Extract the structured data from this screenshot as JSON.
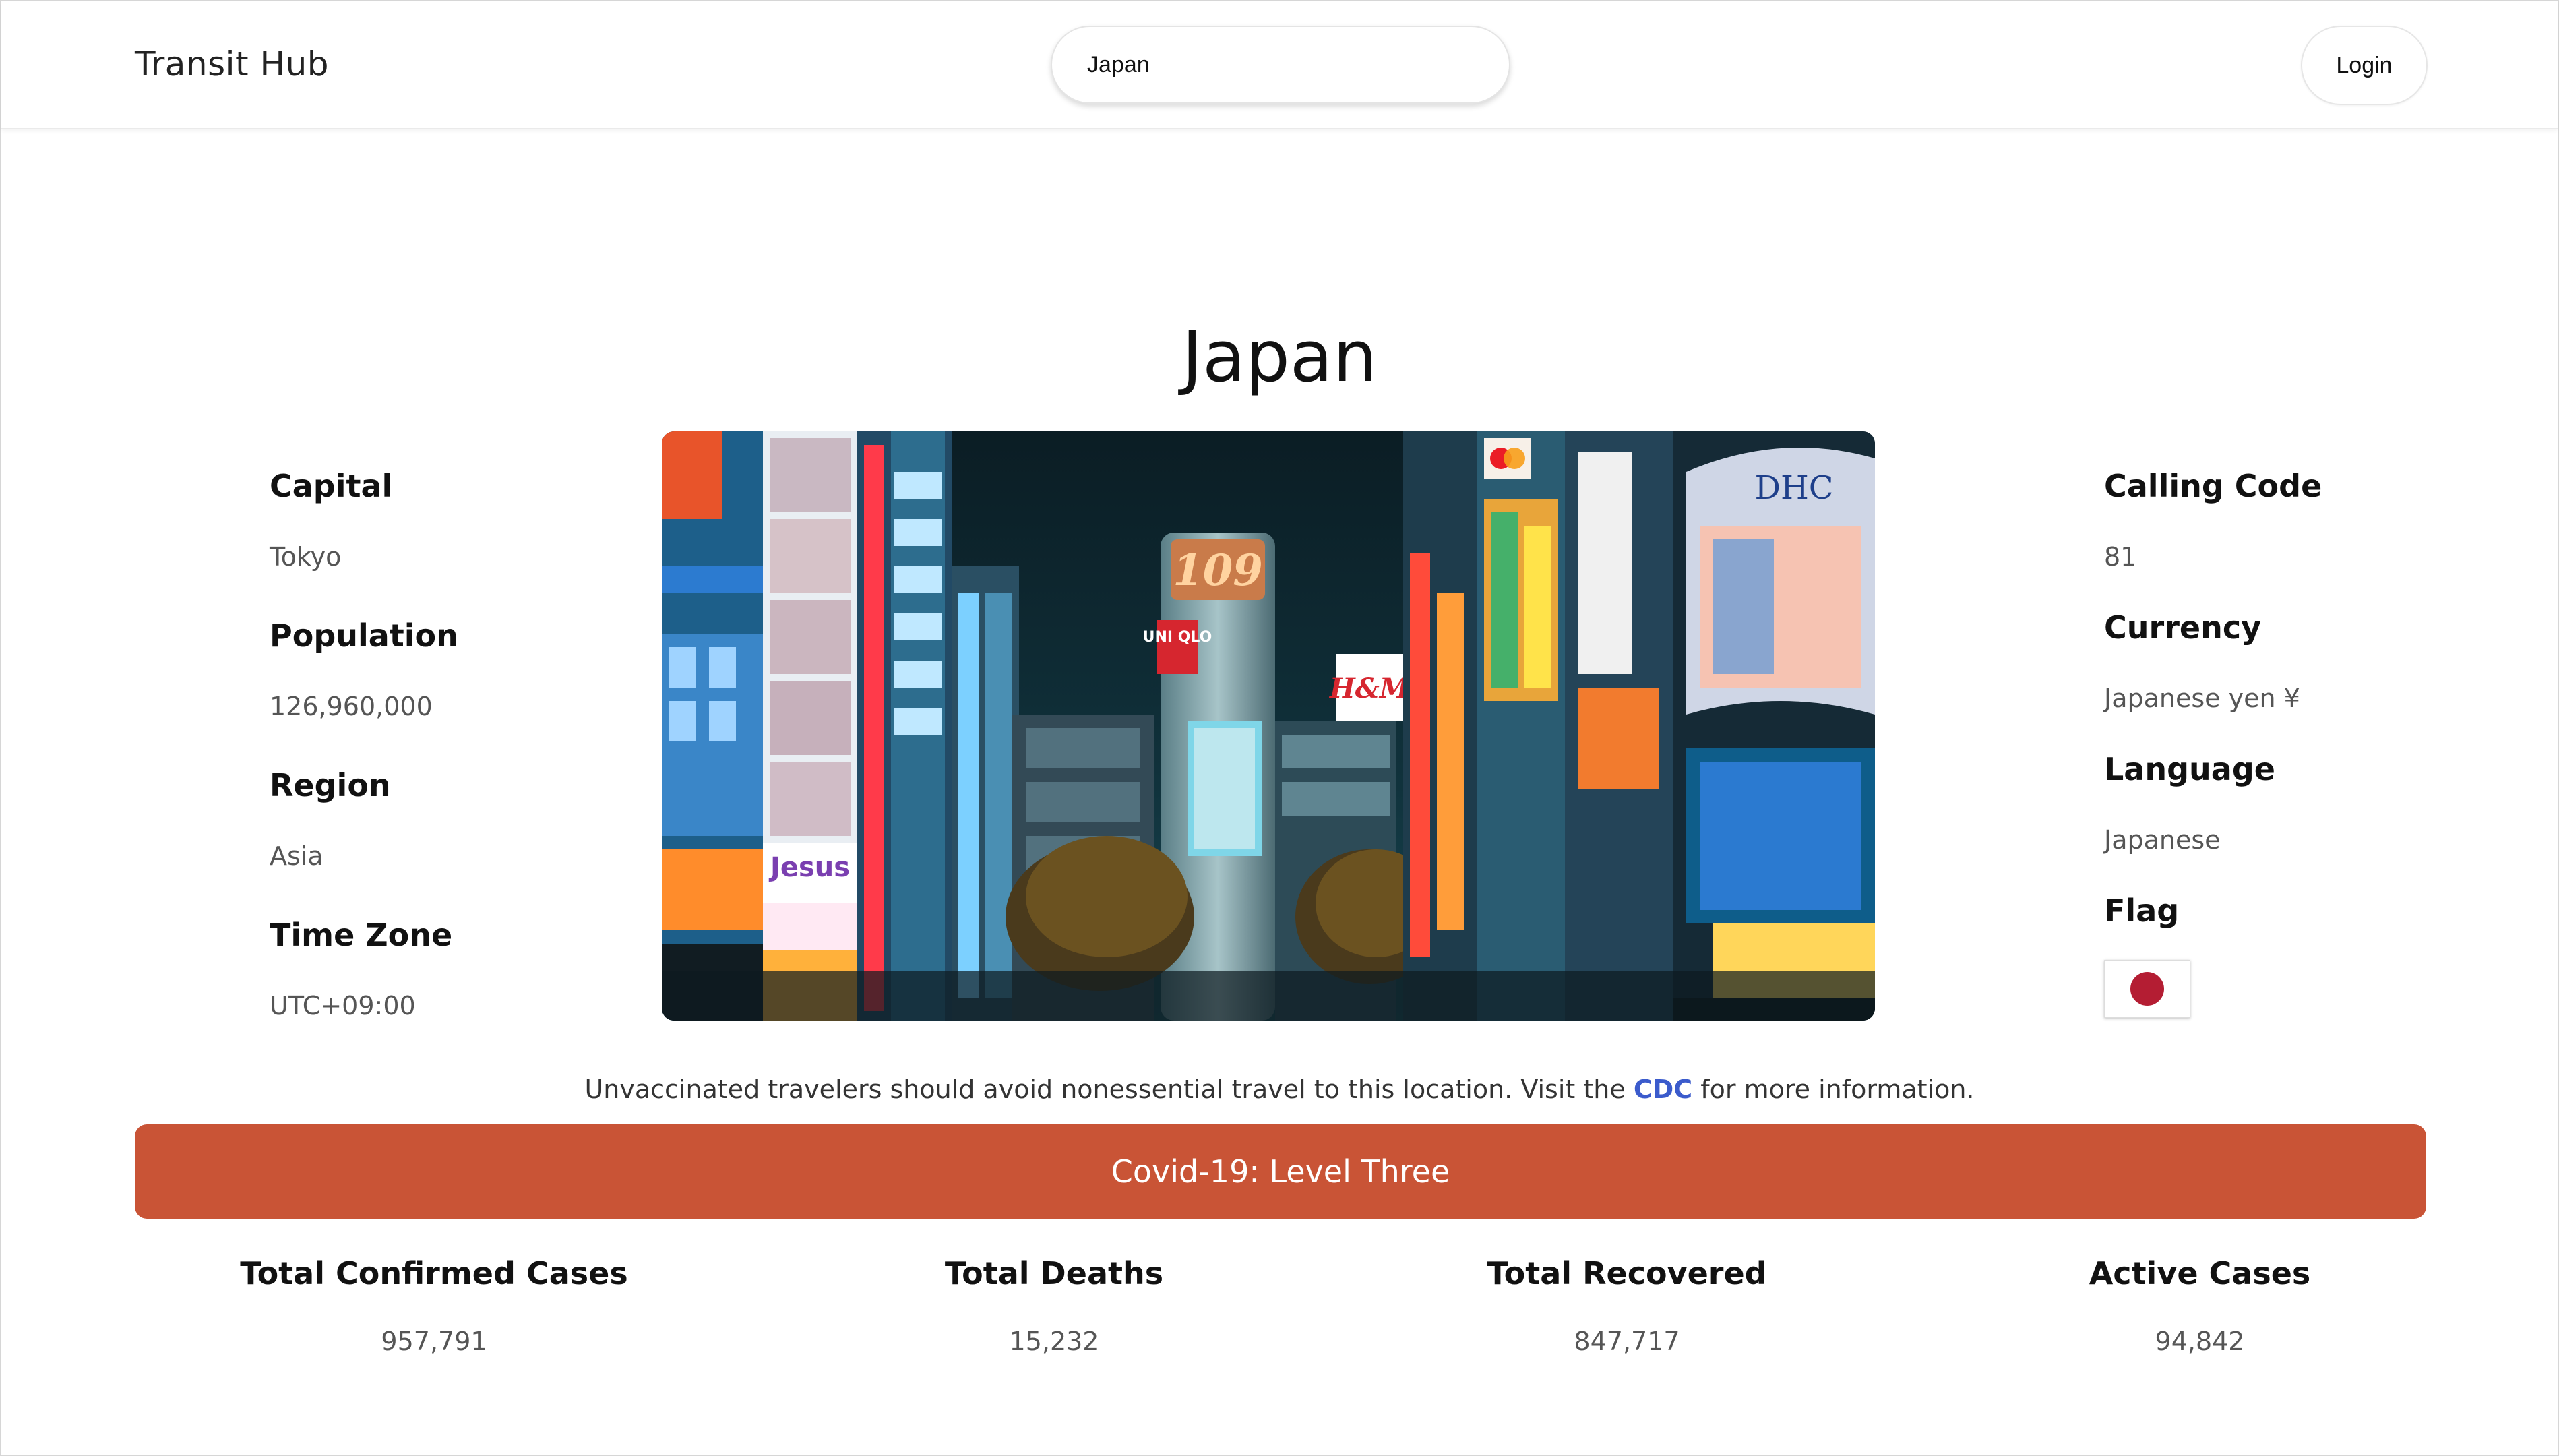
{
  "header": {
    "brand": "Transit Hub",
    "search_value": "Japan",
    "login_label": "Login"
  },
  "country": {
    "name": "Japan",
    "left_facts": [
      {
        "label": "Capital",
        "value": "Tokyo"
      },
      {
        "label": "Population",
        "value": "126,960,000"
      },
      {
        "label": "Region",
        "value": "Asia"
      },
      {
        "label": "Time Zone",
        "value": "UTC+09:00"
      }
    ],
    "right_facts": [
      {
        "label": "Calling Code",
        "value": "81"
      },
      {
        "label": "Currency",
        "value": "Japanese yen ¥"
      },
      {
        "label": "Language",
        "value": "Japanese"
      }
    ],
    "flag_label": "Flag",
    "hero_signs": {
      "sign_109": "109",
      "uniqlo": "UNI QLO",
      "hm": "H&M",
      "dhc": "DHC",
      "jesus": "Jesus"
    }
  },
  "advisory": {
    "text_before": "Unvaccinated travelers should avoid nonessential travel to this location. Visit the ",
    "link": "CDC",
    "text_after": " for more information."
  },
  "covid": {
    "level": "Covid-19: Level Three",
    "stats": [
      {
        "label": "Total Confirmed Cases",
        "value": "957,791"
      },
      {
        "label": "Total Deaths",
        "value": "15,232"
      },
      {
        "label": "Total Recovered",
        "value": "847,717"
      },
      {
        "label": "Active Cases",
        "value": "94,842"
      }
    ]
  },
  "colors": {
    "covid_bar": "#c95436",
    "link": "#3b5bcc",
    "flag_red": "#b41d33"
  }
}
